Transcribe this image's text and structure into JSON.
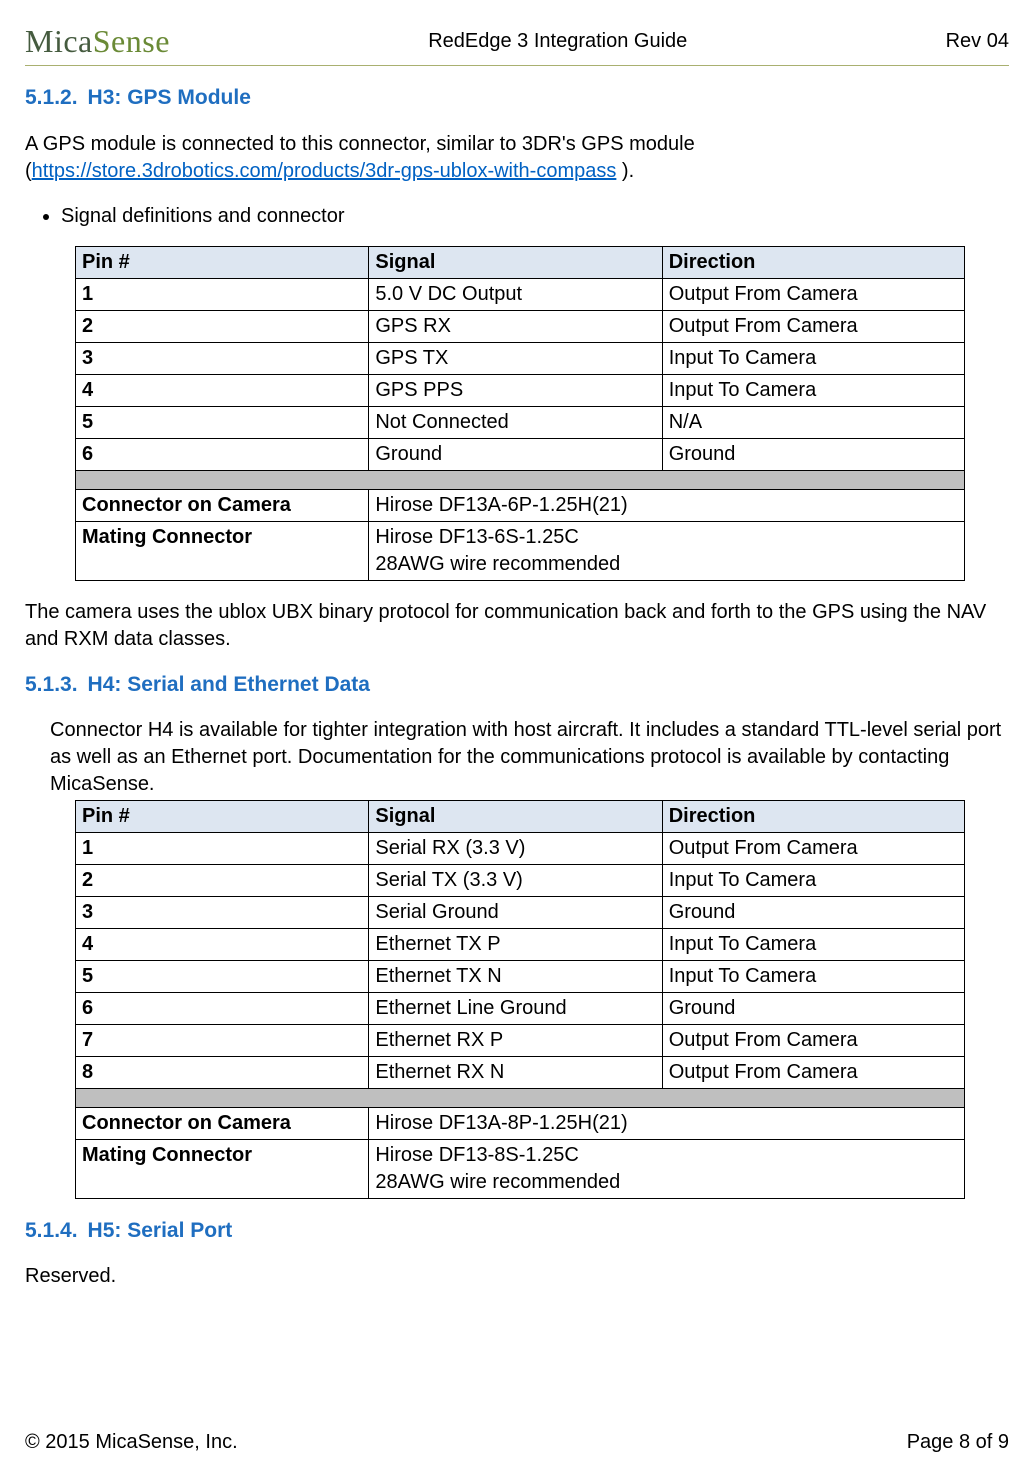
{
  "header": {
    "logo_main": "Mica",
    "logo_accent": "Sense",
    "center": "RedEdge 3 Integration Guide",
    "right": "Rev 04"
  },
  "s512": {
    "num": "5.1.2.",
    "title": "H3: GPS Module",
    "intro_a": "A GPS module is connected to this connector, similar to 3DR's GPS module (",
    "link": "https://store.3drobotics.com/products/3dr-gps-ublox-with-compass",
    "intro_b": " ).",
    "bullet": "Signal definitions and connector",
    "table": {
      "h1": "Pin #",
      "h2": "Signal",
      "h3": "Direction",
      "rows": [
        {
          "p": "1",
          "s": "5.0 V DC Output",
          "d": "Output From Camera"
        },
        {
          "p": "2",
          "s": "GPS RX",
          "d": "Output From Camera"
        },
        {
          "p": "3",
          "s": "GPS TX",
          "d": "Input To Camera"
        },
        {
          "p": "4",
          "s": "GPS PPS",
          "d": "Input To Camera"
        },
        {
          "p": "5",
          "s": "Not Connected",
          "d": "N/A"
        },
        {
          "p": "6",
          "s": "Ground",
          "d": "Ground"
        }
      ],
      "conn_label": "Connector on Camera",
      "conn_val": "Hirose DF13A-6P-1.25H(21)",
      "mate_label": "Mating Connector",
      "mate_val": "Hirose DF13-6S-1.25C\n28AWG wire recommended"
    },
    "after": "The camera uses the ublox UBX binary protocol for communication back and forth to the GPS using the NAV and RXM data classes."
  },
  "s513": {
    "num": "5.1.3.",
    "title": "H4: Serial and Ethernet Data",
    "intro": "Connector H4 is available for tighter integration with host aircraft. It includes a standard TTL-level serial port as well as an Ethernet port. Documentation for the communications protocol is available by contacting MicaSense.",
    "table": {
      "h1": "Pin #",
      "h2": "Signal",
      "h3": "Direction",
      "rows": [
        {
          "p": "1",
          "s": "Serial RX (3.3 V)",
          "d": "Output From Camera"
        },
        {
          "p": "2",
          "s": "Serial TX  (3.3 V)",
          "d": "Input To Camera"
        },
        {
          "p": "3",
          "s": "Serial Ground",
          "d": "Ground"
        },
        {
          "p": "4",
          "s": "Ethernet TX P",
          "d": "Input To Camera"
        },
        {
          "p": "5",
          "s": "Ethernet TX N",
          "d": "Input To Camera"
        },
        {
          "p": "6",
          "s": "Ethernet Line Ground",
          "d": "Ground"
        },
        {
          "p": "7",
          "s": "Ethernet RX P",
          "d": "Output From Camera"
        },
        {
          "p": "8",
          "s": "Ethernet RX N",
          "d": "Output From Camera"
        }
      ],
      "conn_label": "Connector on Camera",
      "conn_val": "Hirose DF13A-8P-1.25H(21)",
      "mate_label": "Mating Connector",
      "mate_val": "Hirose DF13-8S-1.25C\n28AWG wire recommended"
    }
  },
  "s514": {
    "num": "5.1.4.",
    "title": "H5: Serial Port",
    "body": "Reserved."
  },
  "footer": {
    "left": "© 2015 MicaSense, Inc.",
    "right": "Page 8 of 9"
  }
}
